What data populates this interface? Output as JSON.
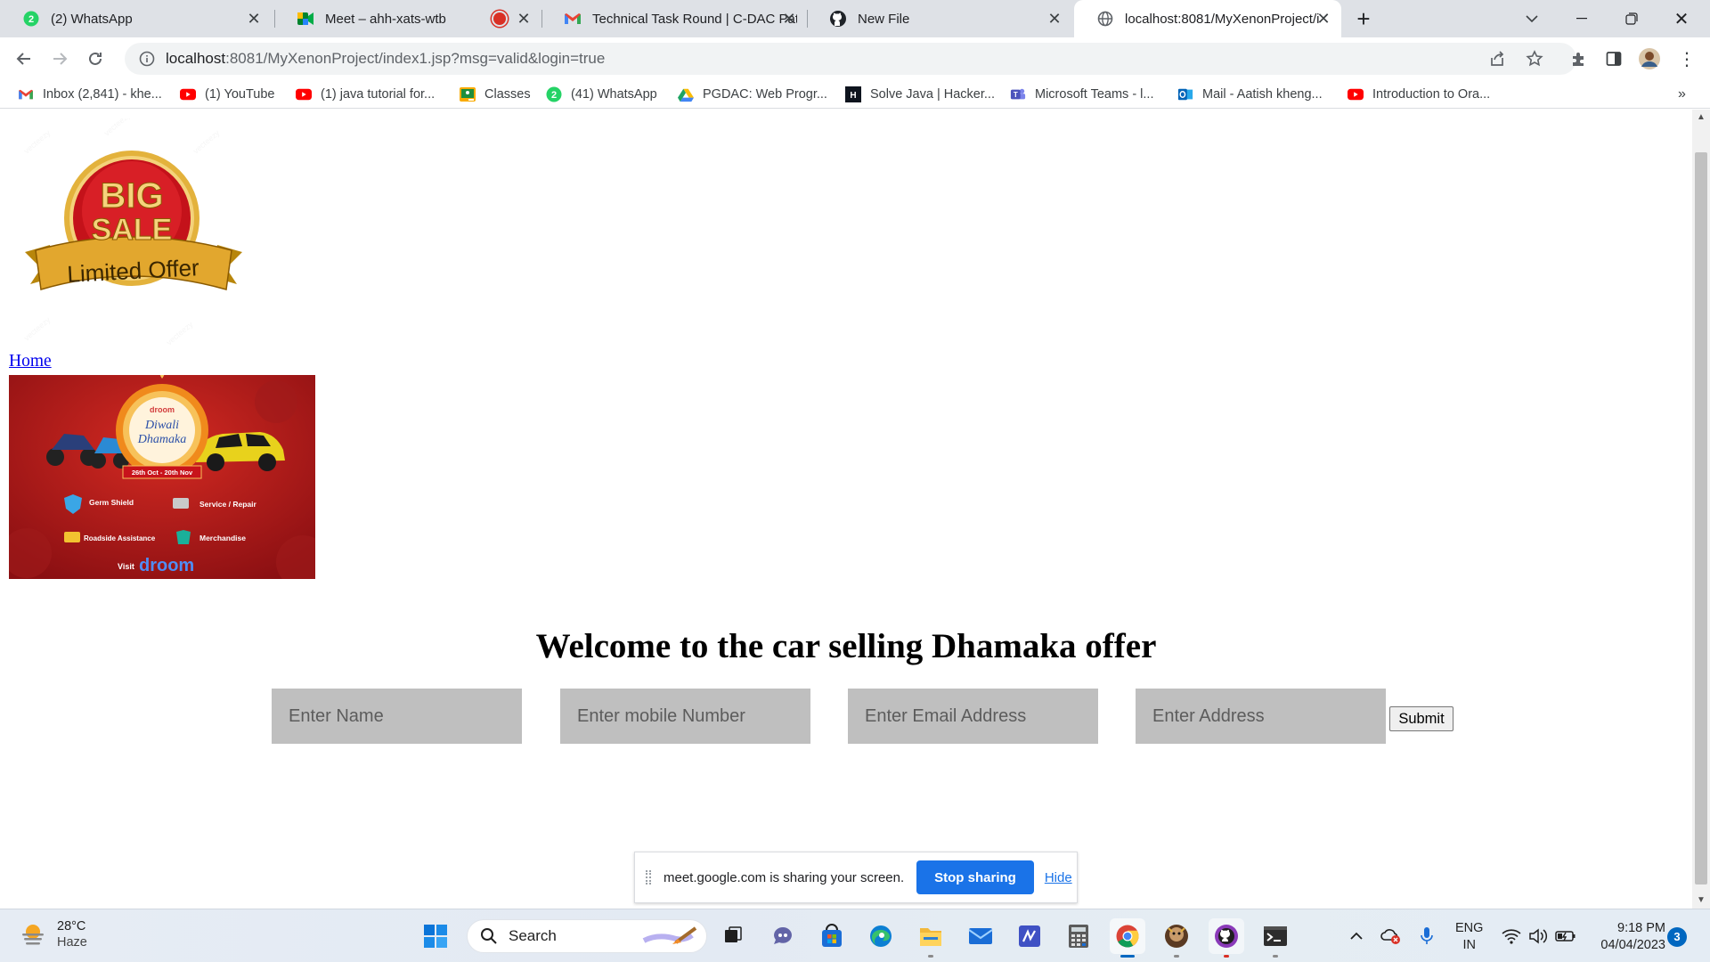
{
  "tabs": [
    {
      "title": "(2) WhatsApp",
      "favicon": "whatsapp-icon",
      "badge": "2"
    },
    {
      "title": "Meet – ahh-xats-wtb",
      "favicon": "google-meet-icon",
      "recording": true
    },
    {
      "title": "Technical Task Round | C-DAC Pat",
      "favicon": "gmail-icon"
    },
    {
      "title": "New File",
      "favicon": "github-icon"
    },
    {
      "title": "localhost:8081/MyXenonProject/i",
      "favicon": "globe-icon",
      "active": true
    }
  ],
  "address_bar": {
    "host": "localhost",
    "path": ":8081/MyXenonProject/index1.jsp?msg=valid&login=true"
  },
  "bookmarks": [
    {
      "label": "Inbox (2,841) - khe...",
      "icon": "gmail-icon"
    },
    {
      "label": "(1) YouTube",
      "icon": "youtube-icon"
    },
    {
      "label": "(1) java tutorial for...",
      "icon": "youtube-icon"
    },
    {
      "label": "Classes",
      "icon": "classroom-icon"
    },
    {
      "label": "(41) WhatsApp",
      "icon": "whatsapp-icon"
    },
    {
      "label": "PGDAC: Web Progr...",
      "icon": "google-drive-icon"
    },
    {
      "label": "Solve Java | Hacker...",
      "icon": "hackerrank-icon"
    },
    {
      "label": "Microsoft Teams - l...",
      "icon": "teams-icon"
    },
    {
      "label": "Mail - Aatish kheng...",
      "icon": "outlook-icon"
    },
    {
      "label": "Introduction to Ora...",
      "icon": "youtube-icon"
    }
  ],
  "page": {
    "logo": {
      "line1": "BIG",
      "line2": "SALE",
      "ribbon": "Limited Offer"
    },
    "home_link": "Home",
    "promo": {
      "brand": "droom",
      "title_line1": "Diwali",
      "title_line2": "Dhamaka",
      "dates": "26th Oct - 20th Nov",
      "features": [
        "Germ Shield",
        "Service / Repair",
        "Roadside Assistance",
        "Merchandise"
      ],
      "visit": "Visit",
      "visit_brand": "droom"
    },
    "heading": "Welcome to the car selling Dhamaka offer",
    "form": {
      "name_placeholder": "Enter Name",
      "mobile_placeholder": "Enter mobile Number",
      "email_placeholder": "Enter Email Address",
      "address_placeholder": "Enter Address",
      "submit_label": "Submit"
    }
  },
  "share_bar": {
    "message": "meet.google.com is sharing your screen.",
    "stop_label": "Stop sharing",
    "hide_label": "Hide"
  },
  "taskbar": {
    "weather": {
      "temp": "28°C",
      "condition": "Haze"
    },
    "search_label": "Search",
    "language": {
      "line1": "ENG",
      "line2": "IN"
    },
    "time": "9:18 PM",
    "date": "04/04/2023",
    "notification_count": "3"
  },
  "colors": {
    "tab_strip": "#dee1e6",
    "link": "#0000ee",
    "input_bg": "#bfbfbf",
    "accent_blue": "#1a73e8",
    "promo_red": "#b0141a"
  }
}
